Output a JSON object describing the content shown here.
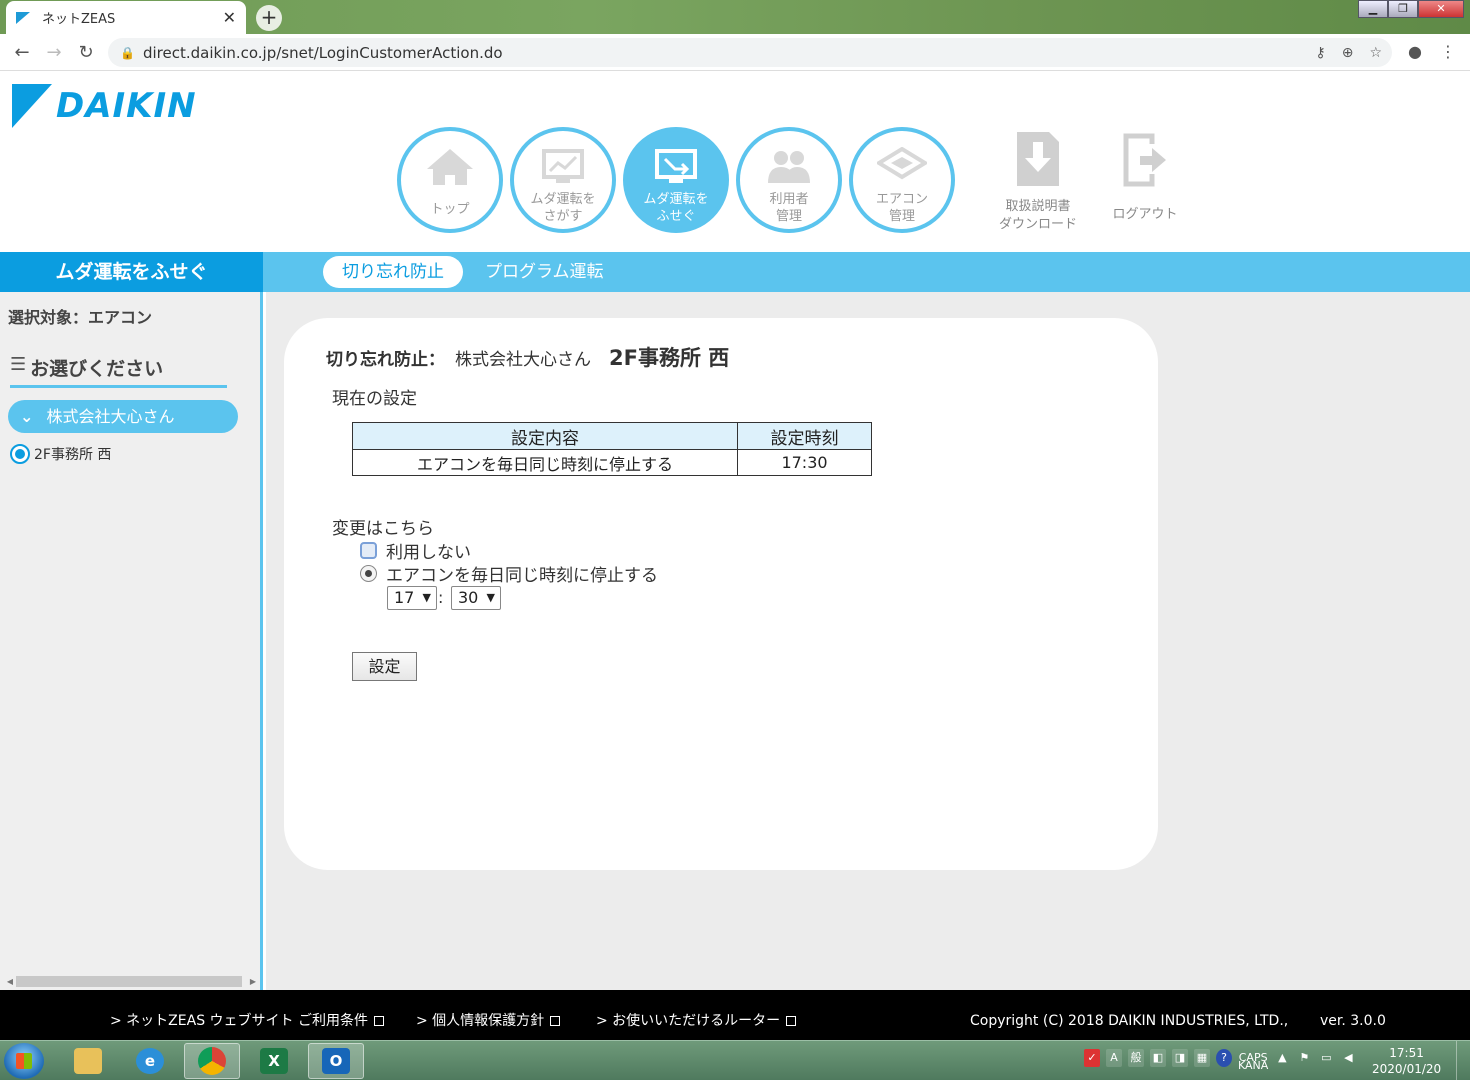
{
  "browser": {
    "tab_title": "ネットZEAS",
    "tab_close": "✕",
    "new_tab": "+",
    "url": "direct.daikin.co.jp/snet/LoginCustomerAction.do",
    "win_buttons": [
      "▁",
      "❐",
      "✕"
    ]
  },
  "brand": {
    "logo_text": "DAIKIN",
    "color": "#0b9de0",
    "accent": "#5bc4ee"
  },
  "nav": {
    "top": "トップ",
    "search_waste": [
      "ムダ運転を",
      "さがす"
    ],
    "prevent_waste": [
      "ムダ運転を",
      "ふせぐ"
    ],
    "users": [
      "利用者",
      "管理"
    ],
    "aircon": [
      "エアコン",
      "管理"
    ],
    "manual": [
      "取扱説明書",
      "ダウンロード"
    ],
    "logout": "ログアウト"
  },
  "bar": {
    "section": "ムダ運転をふせぐ",
    "tabs": [
      {
        "label": "切り忘れ防止",
        "active": true
      },
      {
        "label": "プログラム運転",
        "active": false
      }
    ]
  },
  "sidebar": {
    "target": "選択対象：エアコン",
    "heading": "お選びください",
    "company": "株式会社大心さん",
    "item": "2F事務所 西"
  },
  "main": {
    "title_prefix": "切り忘れ防止：",
    "company": "株式会社大心さん",
    "location": "2F事務所 西",
    "current_label": "現在の設定",
    "table": {
      "headers": [
        "設定内容",
        "設定時刻"
      ],
      "rows": [
        [
          "エアコンを毎日同じ時刻に停止する",
          "17:30"
        ]
      ]
    },
    "change_label": "変更はこちら",
    "options": [
      "利用しない",
      "エアコンを毎日同じ時刻に停止する"
    ],
    "selected_option": 1,
    "hour": "17",
    "minute": "30",
    "colon": ":",
    "set_button": "設定"
  },
  "footer": {
    "links": [
      "> ネットZEAS ウェブサイト ご利用条件",
      "> 個人情報保護方針",
      "> お使いいただけるルーター"
    ],
    "copyright": "Copyright (C) 2018 DAIKIN INDUSTRIES, LTD.,",
    "version": "ver. 3.0.0"
  },
  "taskbar": {
    "apps": [
      "explorer",
      "ie",
      "chrome",
      "excel",
      "outlook"
    ],
    "time": "17:51",
    "date": "2020/01/20",
    "tray_text": [
      "A",
      "般"
    ],
    "caps_label": "CAPS",
    "kana_label": "KANA"
  }
}
